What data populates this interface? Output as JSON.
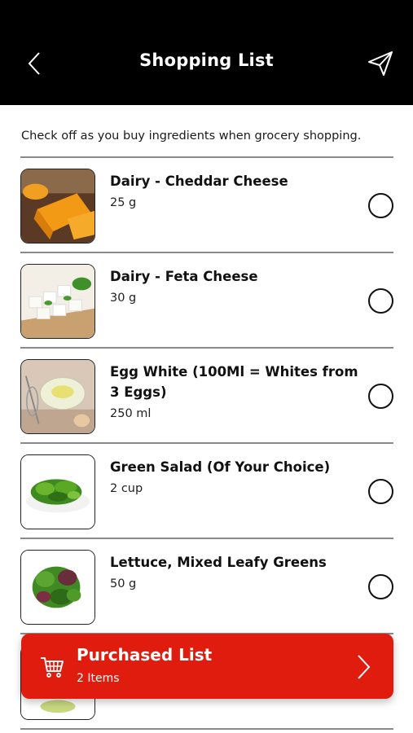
{
  "header": {
    "title": "Shopping List",
    "back_icon": "chevron-left-icon",
    "share_icon": "paper-plane-icon"
  },
  "intro": "Check off as you buy ingredients when grocery shopping.",
  "items": [
    {
      "name": "Dairy - Cheddar Cheese",
      "qty": "25 g",
      "checked": false,
      "image": "cheddar-cheese"
    },
    {
      "name": "Dairy - Feta Cheese",
      "qty": "30 g",
      "checked": false,
      "image": "feta-cheese"
    },
    {
      "name": "Egg White (100Ml = Whites from 3 Eggs)",
      "qty": "250 ml",
      "checked": false,
      "image": "egg-white"
    },
    {
      "name": "Green Salad (Of Your Choice)",
      "qty": "2 cup",
      "checked": false,
      "image": "green-salad"
    },
    {
      "name": "Lettuce, Mixed Leafy Greens",
      "qty": "50 g",
      "checked": false,
      "image": "mixed-greens"
    }
  ],
  "purchased": {
    "title": "Purchased List",
    "count": "2 Items",
    "icon": "cart-icon"
  },
  "colors": {
    "header_bg": "#000000",
    "accent": "#e01c0e"
  }
}
